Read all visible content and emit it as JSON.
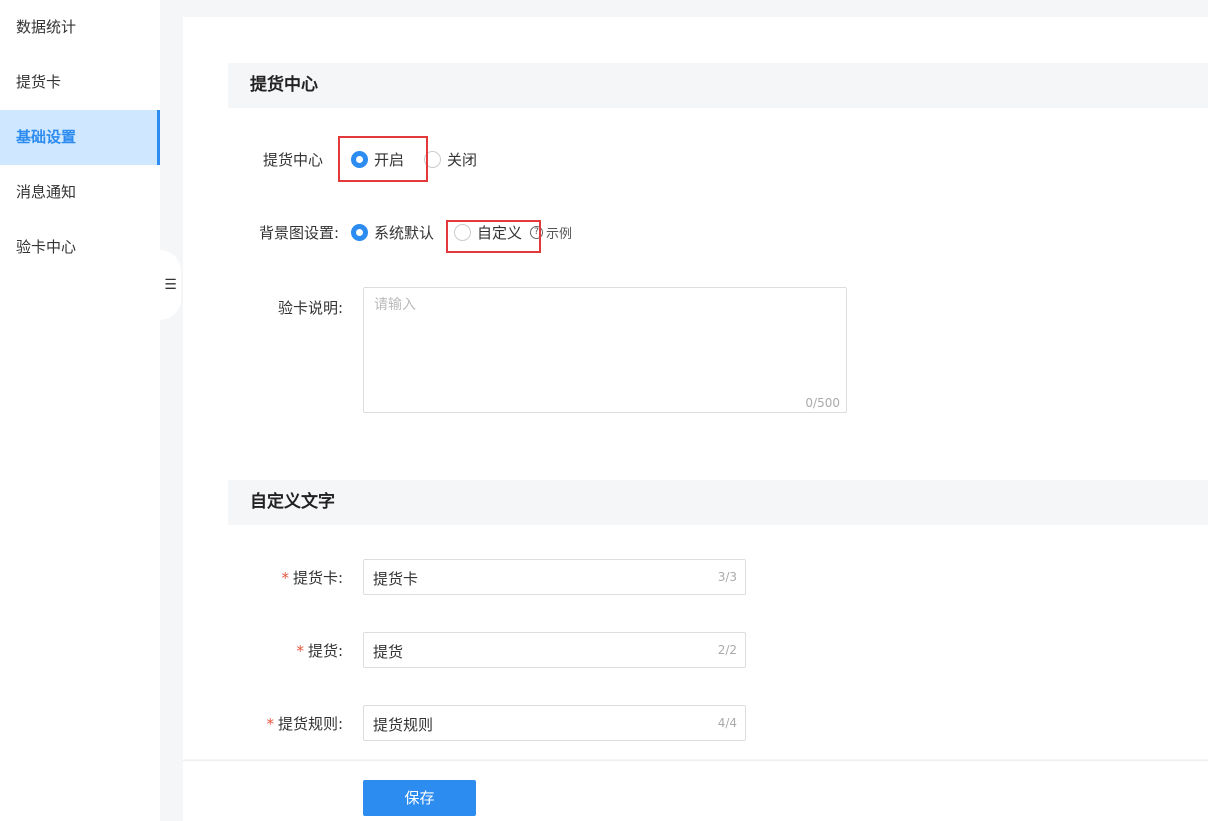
{
  "sidebar": {
    "items": [
      {
        "label": "数据统计"
      },
      {
        "label": "提货卡"
      },
      {
        "label": "基础设置"
      },
      {
        "label": "消息通知"
      },
      {
        "label": "验卡中心"
      }
    ],
    "active_index": 2
  },
  "section1": {
    "title": "提货中心",
    "center_label": "提货中心",
    "center_options": [
      "开启",
      "关闭"
    ],
    "center_selected": "开启",
    "bg_label": "背景图设置:",
    "bg_options": [
      "系统默认",
      "自定义"
    ],
    "bg_selected": "系统默认",
    "example_label": "示例",
    "desc_label": "验卡说明:",
    "desc_placeholder": "请输入",
    "desc_count": "0/500"
  },
  "section2": {
    "title": "自定义文字",
    "fields": [
      {
        "label": "提货卡:",
        "value": "提货卡",
        "count": "3/3"
      },
      {
        "label": "提货:",
        "value": "提货",
        "count": "2/2"
      },
      {
        "label": "提货规则:",
        "value": "提货规则",
        "count": "4/4"
      }
    ]
  },
  "footer": {
    "save_label": "保存"
  },
  "colors": {
    "accent": "#2d8cf0",
    "highlight": "#e23a3a",
    "required": "#e8553e"
  }
}
